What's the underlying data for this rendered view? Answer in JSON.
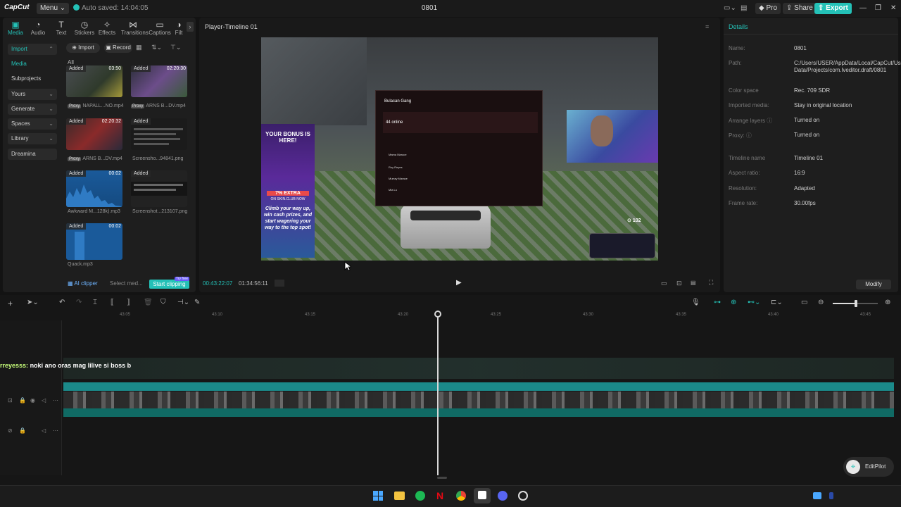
{
  "titlebar": {
    "logo": "CapCut",
    "menu_label": "Menu",
    "autosave_text": "Auto saved: 14:04:05",
    "window_title": "0801",
    "pro_label": "Pro",
    "share_label": "Share",
    "export_label": "Export"
  },
  "tooltabs": [
    "Media",
    "Audio",
    "Text",
    "Stickers",
    "Effects",
    "Transitions",
    "Captions",
    "Filt"
  ],
  "nav": {
    "import": "Import",
    "media": "Media",
    "subprojects": "Subprojects",
    "yours": "Yours",
    "generate": "Generate",
    "spaces": "Spaces",
    "library": "Library",
    "dreamina": "Dreamina"
  },
  "media_toolbar": {
    "import_label": "Import",
    "record_label": "Record",
    "all_label": "All"
  },
  "media_items": [
    {
      "added": "Added",
      "duration": "03:50",
      "name": "NAPALL...NO.mp4",
      "proxy": "Proxy"
    },
    {
      "added": "Added",
      "duration": "02:20:30",
      "name": "ARNS B...DV.mp4",
      "proxy": "Proxy"
    },
    {
      "added": "Added",
      "duration": "02:20:32",
      "name": "ARNS B...DV.mp4",
      "proxy": "Proxy"
    },
    {
      "added": "Added",
      "duration": "",
      "name": "Screensho...94841.png",
      "proxy": ""
    },
    {
      "added": "Added",
      "duration": "00:02",
      "name": "Awkward M...128k).mp3",
      "proxy": ""
    },
    {
      "added": "Added",
      "duration": "",
      "name": "Screenshot...213107.png",
      "proxy": ""
    },
    {
      "added": "Added",
      "duration": "00:02",
      "name": "Quack.mp3",
      "proxy": ""
    }
  ],
  "media_footer": {
    "ai_clipper": "AI clipper",
    "select_media": "Select med...",
    "start_clipping": "Start clipping",
    "try_badge": "Try free"
  },
  "player": {
    "title": "Player-Timeline 01",
    "current_time": "00:43:22:07",
    "total_time": "01:34:56:11",
    "overlay": {
      "ad_title": "YOUR BONUS IS HERE!",
      "ad_extra": "7% EXTRA",
      "ad_skin": "ON SKIN.CLUB NOW",
      "ad_slogan": "Climb your way up, win cash prizes, and start wagering your way to the top spot!",
      "app_name": "Bulacan Gang",
      "online": "44 online",
      "viewer_count": "102",
      "members": [
        "Mama Marace",
        "Roy Reyes",
        "Murray Marace",
        "Mia Lu"
      ]
    }
  },
  "details": {
    "header": "Details",
    "rows": [
      {
        "label": "Name:",
        "value": "0801"
      },
      {
        "label": "Path:",
        "value": "C:/Users/USER/AppData/Local/CapCut/User Data/Projects/com.lveditor.draft/0801"
      },
      {
        "label": "Color space",
        "value": "Rec. 709 SDR"
      },
      {
        "label": "Imported media:",
        "value": "Stay in original location"
      },
      {
        "label": "Arrange layers",
        "value": "Turned on"
      },
      {
        "label": "Proxy:",
        "value": "Turned on"
      },
      {
        "label": "Timeline name",
        "value": "Timeline 01"
      },
      {
        "label": "Aspect ratio:",
        "value": "16:9"
      },
      {
        "label": "Resolution:",
        "value": "Adapted"
      },
      {
        "label": "Frame rate:",
        "value": "30.00fps"
      }
    ],
    "modify_label": "Modify"
  },
  "timeline": {
    "ruler": [
      "43:05",
      "43:10",
      "43:15",
      "43:20",
      "43:25",
      "43:30",
      "43:35",
      "43:40",
      "43:45"
    ],
    "chat_user": "rreyesss:",
    "chat_message": "noki ano oras mag lilive si boss b"
  },
  "editpilot_label": "EditPilot",
  "colors": {
    "accent": "#24c1b7",
    "background": "#131313",
    "panel": "#1e1e1e"
  }
}
